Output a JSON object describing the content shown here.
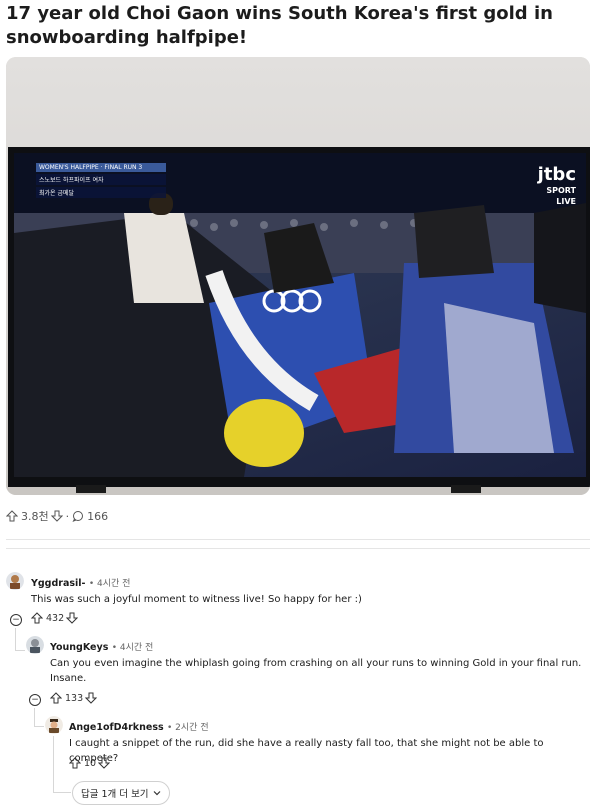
{
  "post": {
    "title": "17 year old Choi Gaon wins South Korea's first gold in snowboarding halfpipe!",
    "upvotes": "3.8천",
    "comments_count": "166"
  },
  "broadcast": {
    "chyron_line1": "WOMEN'S HALFPIPE · FINAL RUN 3",
    "chyron_line2": "스노보드 하프파이프 여자",
    "chyron_line3": "최가온 금메달",
    "channel_top": "jtbc",
    "channel_mid": "SPORT",
    "channel_bottom": "LIVE"
  },
  "comments": [
    {
      "username": "Yggdrasil-",
      "time": "4시간 전",
      "text": "This was such a joyful moment to witness live! So happy for her :)",
      "votes": "432"
    },
    {
      "username": "YoungKeys",
      "time": "4시간 전",
      "text_line1": "Can you even imagine the whiplash going from crashing on all your runs to winning Gold in your final run.",
      "text_line2": "Insane.",
      "votes": "133"
    },
    {
      "username": "Ange1ofD4rkness",
      "time": "2시간 전",
      "text": "I caught a snippet of the run, did she have a really nasty fall too, that she might not be able to compete?",
      "votes": "10"
    }
  ],
  "more_replies_label": "답글 1개 더 보기",
  "icons": {
    "upvote": "upvote-arrow-icon",
    "downvote": "downvote-arrow-icon",
    "comment": "speech-bubble-icon",
    "collapse": "collapse-minus-icon",
    "chevron": "chevron-down-icon"
  }
}
